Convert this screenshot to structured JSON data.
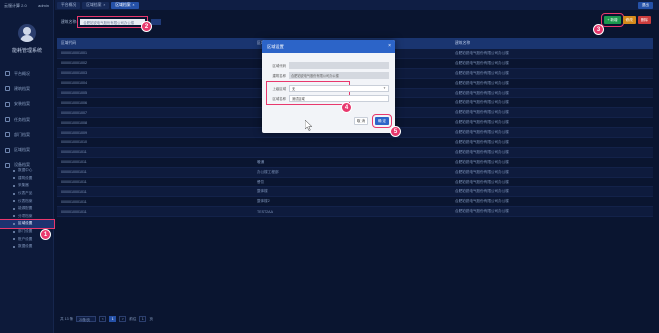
{
  "sidebar": {
    "top_left": "云服计算 2.0",
    "top_right": "admin",
    "system_name": "能耗管理系统",
    "menu": [
      {
        "label": "平台概况",
        "icon": "monitor-icon"
      },
      {
        "label": "建筑档案",
        "icon": "building-icon"
      },
      {
        "label": "安装档案",
        "icon": "install-icon"
      },
      {
        "label": "任务档案",
        "icon": "task-icon"
      },
      {
        "label": "部门档案",
        "icon": "department-icon"
      },
      {
        "label": "区域档案",
        "icon": "area-icon"
      },
      {
        "label": "设备档案",
        "icon": "device-icon"
      },
      {
        "label": "基础设置",
        "icon": "settings-icon"
      }
    ],
    "submenu": [
      {
        "label": "数据中心"
      },
      {
        "label": "建筑设置"
      },
      {
        "label": "采集器"
      },
      {
        "label": "仪表产品"
      },
      {
        "label": "仪表档案"
      },
      {
        "label": "能源配置"
      },
      {
        "label": "分项档案"
      },
      {
        "label": "区域设置",
        "active": true
      },
      {
        "label": "部门设置"
      },
      {
        "label": "账户设置"
      },
      {
        "label": "数据设置"
      }
    ]
  },
  "topbar": {
    "tabs": [
      {
        "label": "平台概况"
      },
      {
        "label": "区域档案"
      },
      {
        "label": "区域档案",
        "active": true
      }
    ],
    "right_button": "退出"
  },
  "filter": {
    "label": "建筑名称:",
    "value": "合肥铂锐电气股份有限公司办公楼"
  },
  "actions": {
    "add": "+ 新增",
    "edit": "修改",
    "delete": "删除"
  },
  "table": {
    "headers": [
      "区域代码",
      "区域名称",
      "建筑名称"
    ],
    "rows": [
      [
        "0000010001001",
        "",
        "合肥铂锐电气股份有限公司办公楼"
      ],
      [
        "0000010001002",
        "",
        "合肥铂锐电气股份有限公司办公楼"
      ],
      [
        "0000010001003",
        "",
        "合肥铂锐电气股份有限公司办公楼"
      ],
      [
        "0000010001004",
        "",
        "合肥铂锐电气股份有限公司办公楼"
      ],
      [
        "0000010001005",
        "",
        "合肥铂锐电气股份有限公司办公楼"
      ],
      [
        "0000010001006",
        "",
        "合肥铂锐电气股份有限公司办公楼"
      ],
      [
        "0000010001007",
        "",
        "合肥铂锐电气股份有限公司办公楼"
      ],
      [
        "0000010001008",
        "",
        "合肥铂锐电气股份有限公司办公楼"
      ],
      [
        "0000010001009",
        "",
        "合肥铂锐电气股份有限公司办公楼"
      ],
      [
        "0000010001010",
        "",
        "合肥铂锐电气股份有限公司办公楼"
      ],
      [
        "0000010001011",
        "",
        "合肥铂锐电气股份有限公司办公楼"
      ],
      [
        "0000010001011",
        "暖通",
        "合肥铂锐电气股份有限公司办公楼"
      ],
      [
        "0000010001011",
        "办公楼工程部",
        "合肥铂锐电气股份有限公司办公楼"
      ],
      [
        "0000010001011",
        "餐饮",
        "合肥铂锐电气股份有限公司办公楼"
      ],
      [
        "0000010001011",
        "整体楼",
        "合肥铂锐电气股份有限公司办公楼"
      ],
      [
        "0000010001011",
        "整体楼2",
        "合肥铂锐电气股份有限公司办公楼"
      ],
      [
        "0000010001011",
        "TEST2AA",
        "合肥铂锐电气股份有限公司办公楼"
      ]
    ]
  },
  "pager": {
    "total": "共 13 条",
    "page_size": "20条/页",
    "prev": "<",
    "current": "1",
    "next": ">",
    "goto_label": "前往",
    "goto_value": "1",
    "page_unit": "页"
  },
  "modal": {
    "title": "区域设置",
    "close": "×",
    "fields": [
      {
        "label": "区域代码",
        "value": ""
      },
      {
        "label": "建筑名称",
        "value": "合肥铂锐电气股份有限公司办公楼"
      },
      {
        "label": "上级区域",
        "value": "无"
      },
      {
        "label": "区域名称",
        "value": "测试区域"
      }
    ],
    "cancel": "取 消",
    "ok": "确 定"
  },
  "badges": [
    "1",
    "2",
    "3",
    "4",
    "5"
  ],
  "colors": {
    "accent": "#2c64c8",
    "highlight": "#e8386d",
    "add_green": "#1b9a4d",
    "edit_orange": "#d58a1a",
    "delete_red": "#cc3d3d"
  }
}
